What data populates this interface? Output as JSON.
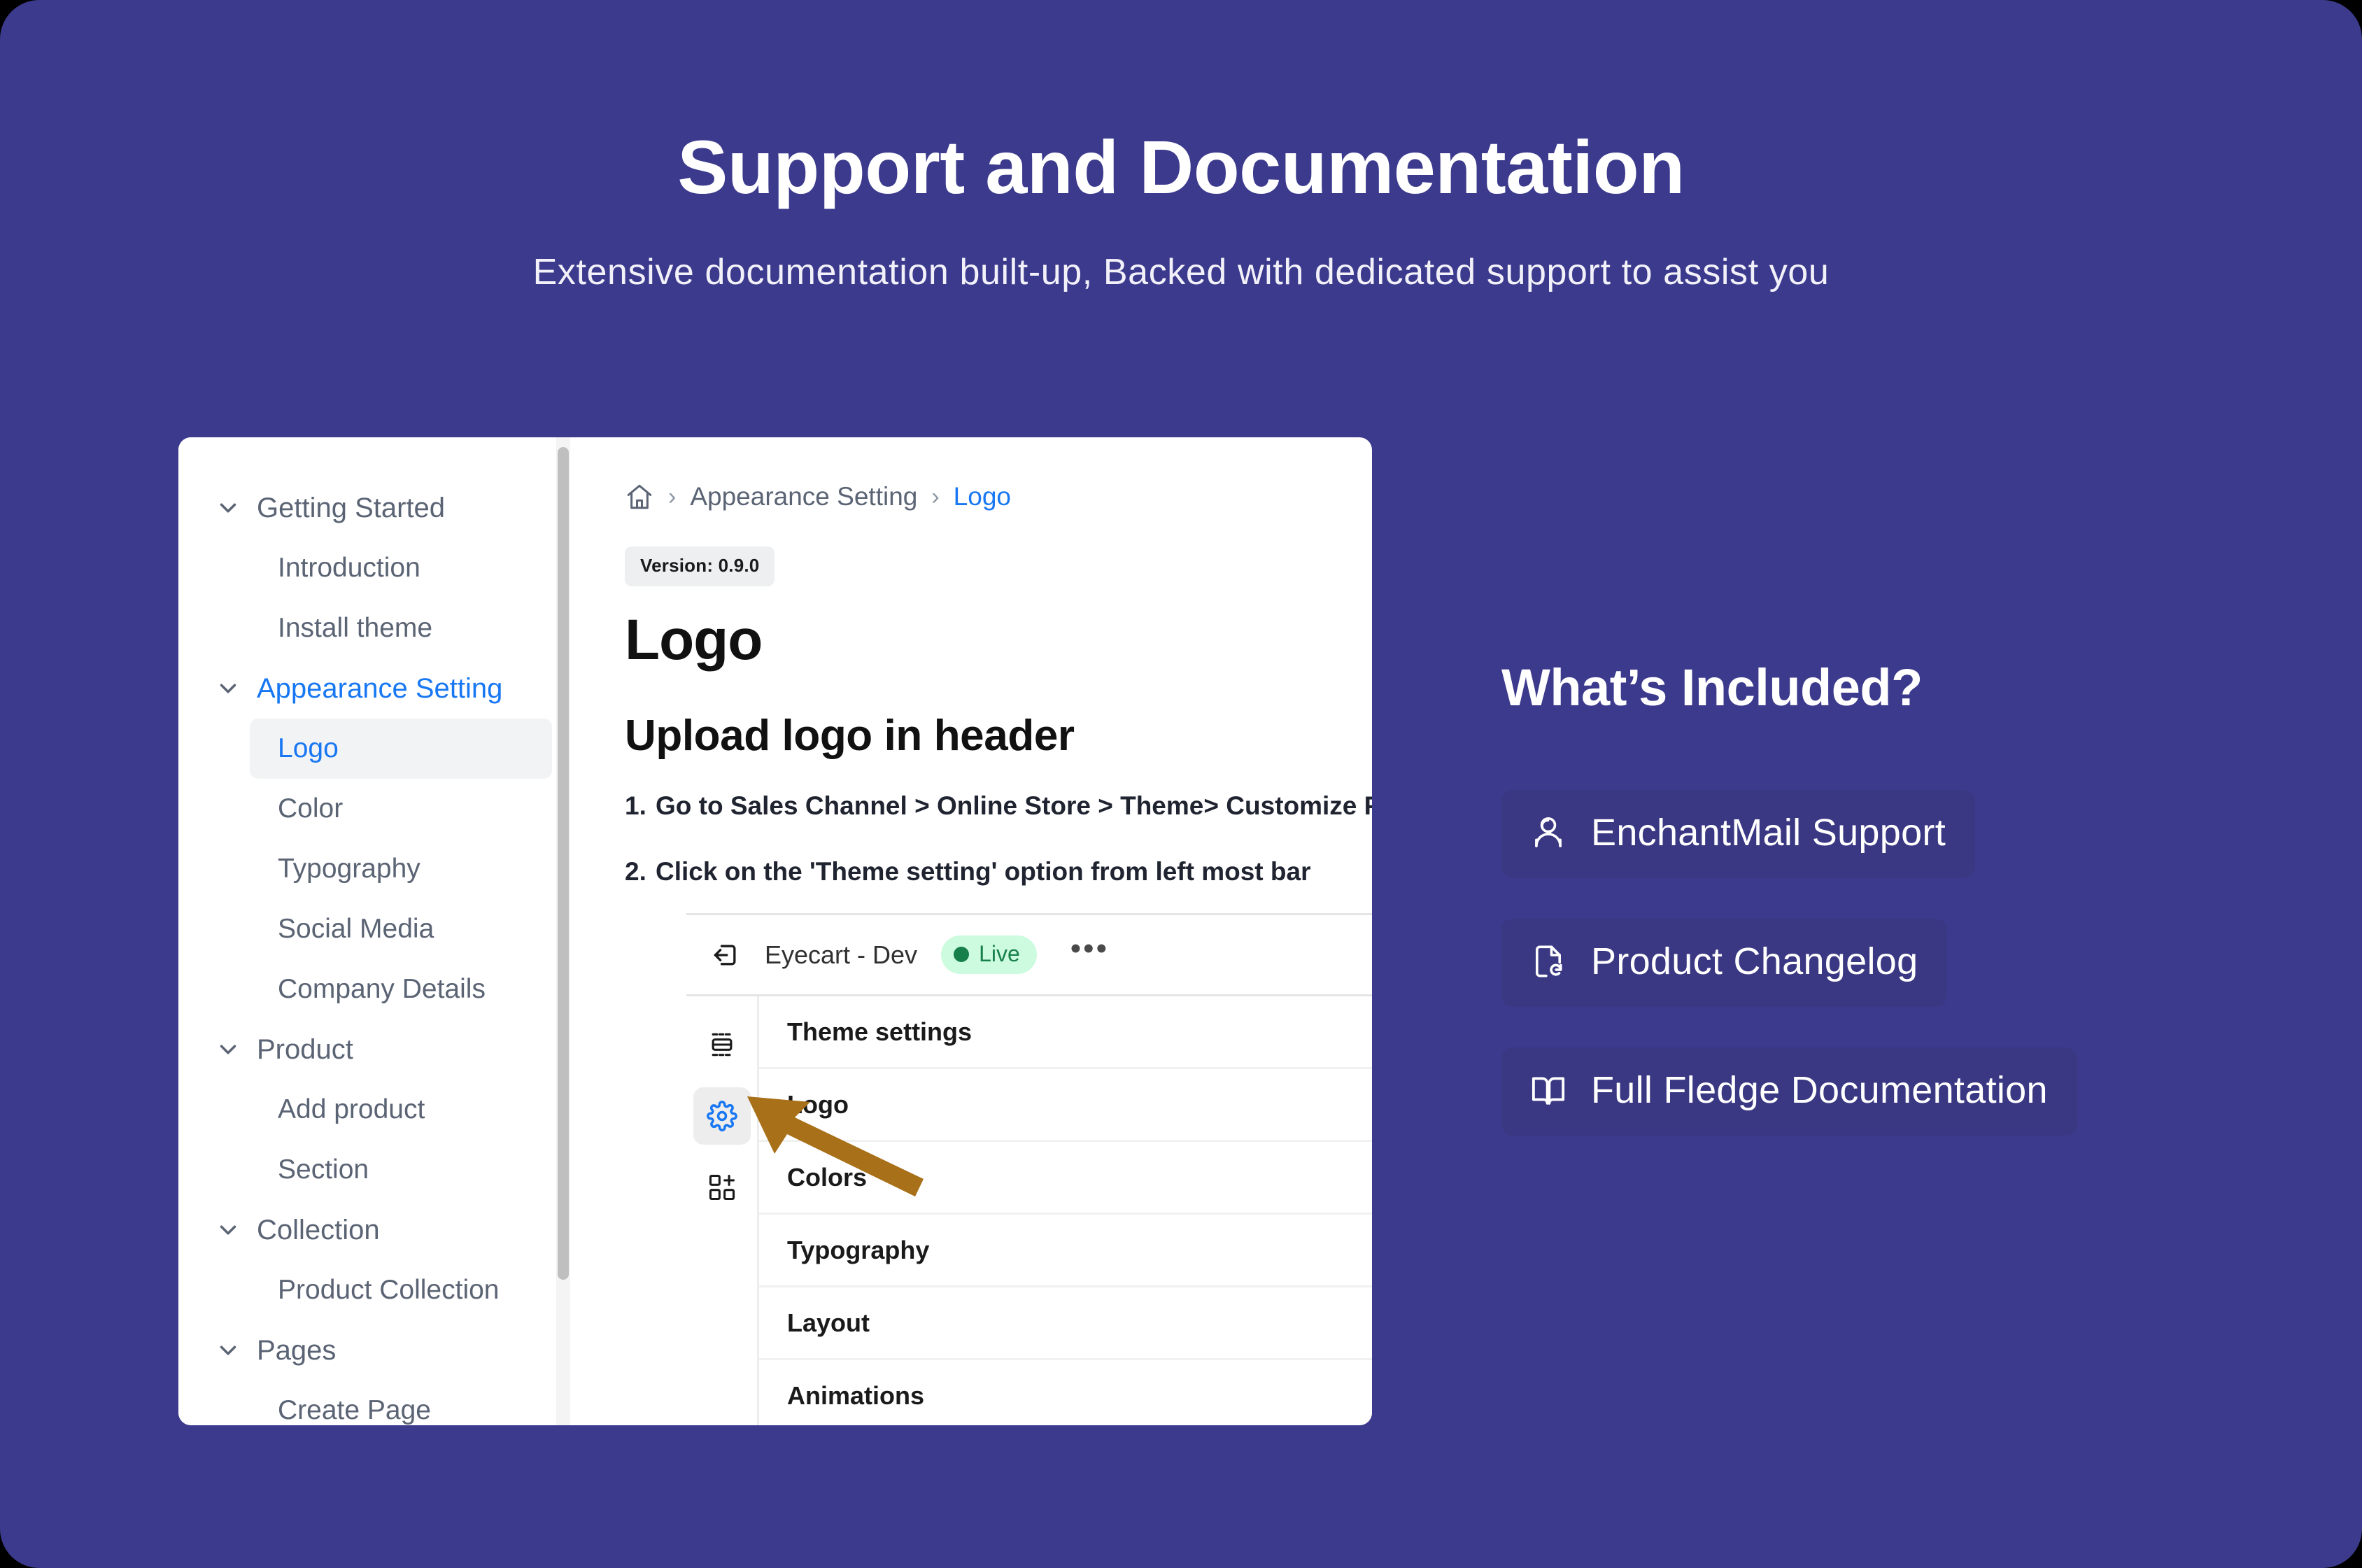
{
  "hero": {
    "title": "Support and Documentation",
    "subtitle": "Extensive documentation built-up, Backed with dedicated support to assist you"
  },
  "doc_sidebar": {
    "groups": [
      {
        "label": "Getting Started",
        "active": false,
        "items": [
          {
            "label": "Introduction",
            "selected": false
          },
          {
            "label": "Install theme",
            "selected": false
          }
        ]
      },
      {
        "label": "Appearance Setting",
        "active": true,
        "items": [
          {
            "label": "Logo",
            "selected": true
          },
          {
            "label": "Color",
            "selected": false
          },
          {
            "label": "Typography",
            "selected": false
          },
          {
            "label": "Social Media",
            "selected": false
          },
          {
            "label": "Company Details",
            "selected": false
          }
        ]
      },
      {
        "label": "Product",
        "active": false,
        "items": [
          {
            "label": "Add product",
            "selected": false
          },
          {
            "label": "Section",
            "selected": false
          }
        ]
      },
      {
        "label": "Collection",
        "active": false,
        "items": [
          {
            "label": "Product Collection",
            "selected": false
          }
        ]
      },
      {
        "label": "Pages",
        "active": false,
        "items": [
          {
            "label": "Create Page",
            "selected": false
          }
        ]
      }
    ]
  },
  "doc_main": {
    "breadcrumb": {
      "home_icon": "home-icon",
      "separator": "›",
      "parent": "Appearance Setting",
      "current": "Logo"
    },
    "version_badge": "Version: 0.9.0",
    "heading": "Logo",
    "subheading": "Upload logo in header",
    "steps": [
      {
        "num": "1.",
        "text": "Go to Sales Channel > Online Store > Theme> Customize Page."
      },
      {
        "num": "2.",
        "text": "Click on the 'Theme setting' option from left most bar"
      }
    ]
  },
  "embed": {
    "exit_icon": "exit-icon",
    "store_name": "Eyecart - Dev",
    "status_badge": "Live",
    "more_menu": "•••",
    "rail_icons": [
      {
        "name": "sections-icon",
        "active": false
      },
      {
        "name": "gear-icon",
        "active": true
      },
      {
        "name": "apps-add-icon",
        "active": false
      }
    ],
    "rows": [
      {
        "label": "Theme settings",
        "chevron": false
      },
      {
        "label": "Logo",
        "chevron": true
      },
      {
        "label": "Colors",
        "chevron": true
      },
      {
        "label": "Typography",
        "chevron": true
      },
      {
        "label": "Layout",
        "chevron": true
      },
      {
        "label": "Animations",
        "chevron": true
      }
    ]
  },
  "right_panel": {
    "title": "What’s Included?",
    "cards": [
      {
        "label": "EnchantMail Support",
        "icon": "support-agent-icon"
      },
      {
        "label": "Product Changelog",
        "icon": "document-refresh-icon"
      },
      {
        "label": "Full Fledge Documentation",
        "icon": "open-book-icon"
      }
    ]
  },
  "colors": {
    "background": "#3C3A8C",
    "card_background": "#3B3883",
    "accent_link": "#1877F2",
    "annotation_arrow": "#A87018",
    "status_live_bg": "#CDFBE0",
    "status_live_fg": "#17804A"
  }
}
